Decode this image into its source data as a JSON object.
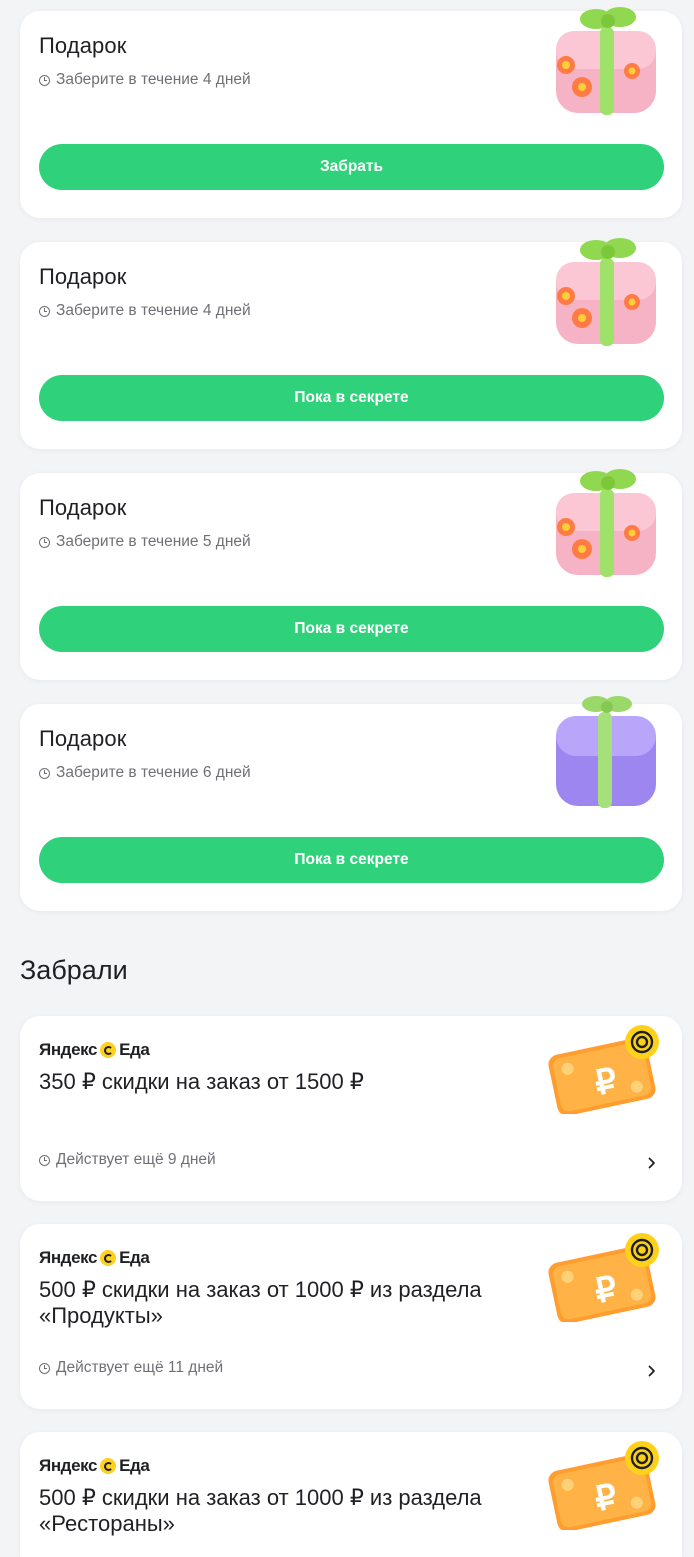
{
  "gifts": [
    {
      "title": "Подарок",
      "subtitle": "Заберите в течение 4 дней",
      "button": "Забрать",
      "gift_color": "pink"
    },
    {
      "title": "Подарок",
      "subtitle": "Заберите в течение 4 дней",
      "button": "Пока в секрете",
      "gift_color": "pink"
    },
    {
      "title": "Подарок",
      "subtitle": "Заберите в течение 5 дней",
      "button": "Пока в секрете",
      "gift_color": "pink"
    },
    {
      "title": "Подарок",
      "subtitle": "Заберите в течение 6 дней",
      "button": "Пока в секрете",
      "gift_color": "purple"
    }
  ],
  "section_title": "Забрали",
  "promos": [
    {
      "brand_left": "Яндекс",
      "brand_right": "Еда",
      "title": "350 ₽ скидки на заказ от 1500 ₽",
      "validity": "Действует ещё 9 дней"
    },
    {
      "brand_left": "Яндекс",
      "brand_right": "Еда",
      "title": "500 ₽ скидки на заказ от 1000 ₽ из раздела «Продукты»",
      "validity": "Действует ещё 11 дней"
    },
    {
      "brand_left": "Яндекс",
      "brand_right": "Еда",
      "title": "500 ₽ скидки на заказ от 1000 ₽ из раздела «Рестораны»",
      "validity": ""
    }
  ],
  "colors": {
    "accent_green": "#2fd27a",
    "muted_text": "#6e7075",
    "brand_yellow": "#ffd11a"
  }
}
